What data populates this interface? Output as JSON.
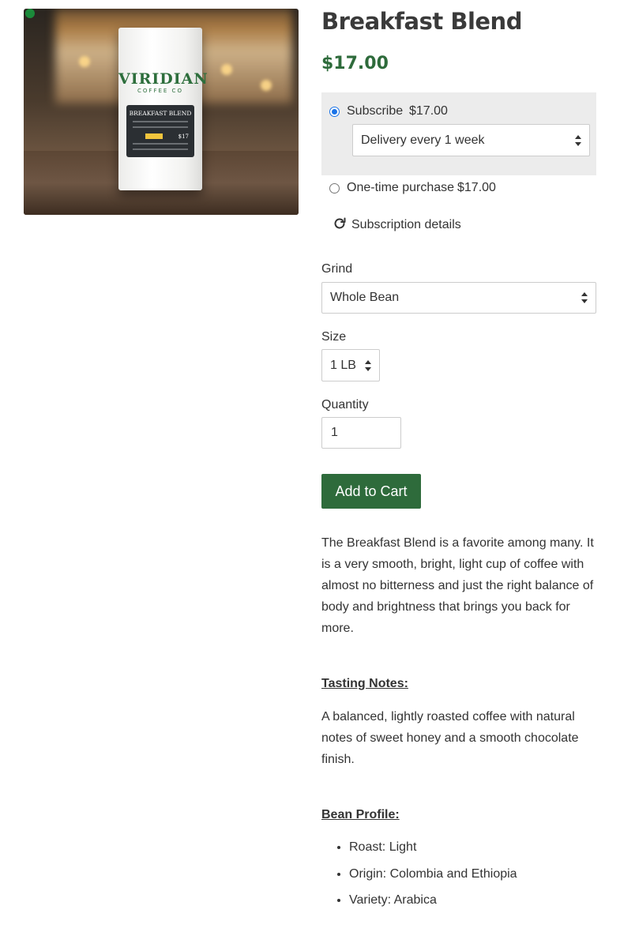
{
  "product": {
    "title": "Breakfast Blend",
    "price": "$17.00",
    "image": {
      "brand_text": "VIRIDIAN",
      "brand_sub": "COFFEE CO",
      "label_title": "BREAKFAST BLEND",
      "label_price": "$17"
    }
  },
  "purchase_options": {
    "subscribe_label": "Subscribe",
    "subscribe_price": "$17.00",
    "subscribe_selected": true,
    "delivery_selected": "Delivery every 1 week",
    "one_time_label": "One-time purchase",
    "one_time_price": "$17.00",
    "details_link": "Subscription details"
  },
  "variants": {
    "grind_label": "Grind",
    "grind_selected": "Whole Bean",
    "size_label": "Size",
    "size_selected": "1 LB",
    "quantity_label": "Quantity",
    "quantity_value": "1"
  },
  "add_to_cart": "Add to Cart",
  "description": {
    "intro": "The Breakfast Blend is a favorite among many. It is a very smooth, bright, light cup of coffee with almost no bitterness and just the right balance of body and brightness that brings you back for more.",
    "tasting_heading": "Tasting Notes:",
    "tasting_text": "A balanced, lightly roasted coffee with natural notes of sweet honey and a smooth chocolate finish.",
    "profile_heading": "Bean Profile:",
    "profile_items": [
      "Roast: Light",
      "Origin: Colombia and Ethiopia",
      "Variety: Arabica"
    ]
  },
  "colors": {
    "accent": "#2e6b3b",
    "radio": "#1a73e8",
    "option_bg": "#ececec"
  }
}
